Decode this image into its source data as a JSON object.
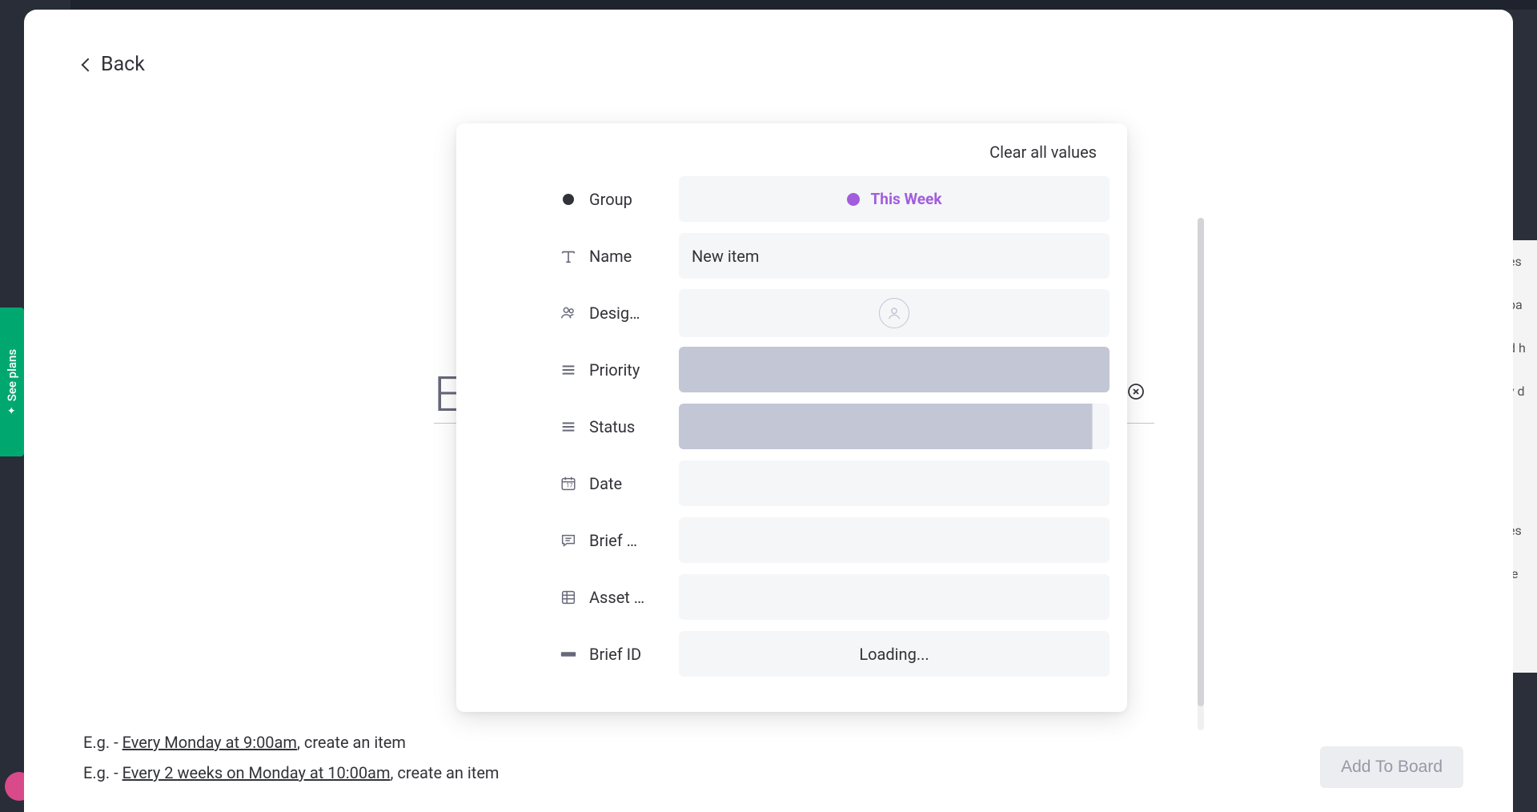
{
  "back_label": "Back",
  "see_plans_label": "See plans",
  "clear_label": "Clear all values",
  "fields": {
    "group": {
      "label": "Group",
      "value": "This Week"
    },
    "name": {
      "label": "Name",
      "value": "New item"
    },
    "designer": {
      "label": "Desig…",
      "value": ""
    },
    "priority": {
      "label": "Priority",
      "value": ""
    },
    "status": {
      "label": "Status",
      "value": ""
    },
    "date": {
      "label": "Date",
      "value": ""
    },
    "brief": {
      "label": "Brief …",
      "value": ""
    },
    "asset": {
      "label": "Asset …",
      "value": ""
    },
    "brief_id": {
      "label": "Brief ID",
      "value": "Loading..."
    }
  },
  "blurred_char": "E",
  "examples": {
    "prefix": "E.g. - ",
    "line1_u": "Every Monday at 9:00am",
    "line1_suffix": ", create an item",
    "line2_u": "Every 2 weeks on Monday at 10:00am",
    "line2_suffix": ", create an item"
  },
  "add_button_label": "Add To Board",
  "bg_snippets": [
    "es",
    "ba",
    "d h",
    "y d",
    "es",
    "le"
  ],
  "colors": {
    "accent_purple": "#a25ddc",
    "green": "#00a870"
  }
}
